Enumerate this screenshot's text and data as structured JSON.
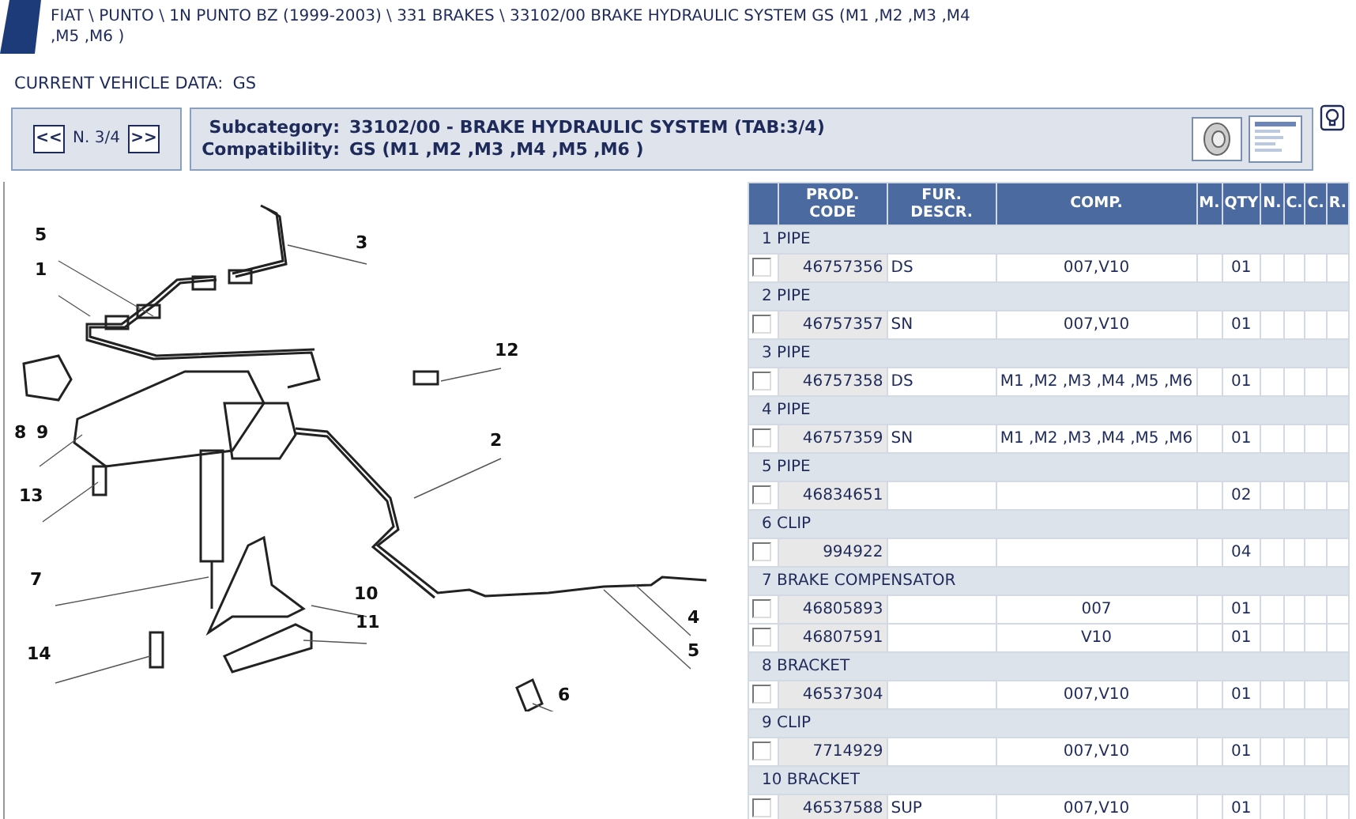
{
  "breadcrumb": "FIAT \\ PUNTO \\ 1N PUNTO BZ (1999-2003) \\ 331 BRAKES \\ 33102/00 BRAKE HYDRAULIC SYSTEM GS (M1 ,M2 ,M3 ,M4 ,M5 ,M6 )",
  "vehicle": {
    "label": "CURRENT VEHICLE DATA:",
    "value": "GS"
  },
  "nav": {
    "prev": "<<",
    "page": "N. 3/4",
    "next": ">>"
  },
  "info": {
    "subcategory_label": "Subcategory:",
    "subcategory": "33102/00 - BRAKE HYDRAULIC SYSTEM (TAB:3/4)",
    "compatibility_label": "Compatibility:",
    "compatibility": "GS (M1 ,M2 ,M3 ,M4 ,M5 ,M6 )"
  },
  "diagram": {
    "callouts": [
      "5",
      "1",
      "3",
      "12",
      "8",
      "9",
      "2",
      "13",
      "7",
      "10",
      "11",
      "14",
      "4",
      "5",
      "6"
    ]
  },
  "table": {
    "columns": [
      "PROD. CODE",
      "FUR. DESCR.",
      "COMP.",
      "M.",
      "QTY",
      "N.",
      "C.",
      "C.",
      "R."
    ],
    "rows": [
      {
        "kind": "group",
        "label": "1 PIPE"
      },
      {
        "kind": "part",
        "checked": false,
        "code": "46757356",
        "fur": "DS",
        "comp": "007,V10",
        "qty": "01"
      },
      {
        "kind": "group",
        "label": "2 PIPE"
      },
      {
        "kind": "part",
        "checked": false,
        "code": "46757357",
        "fur": "SN",
        "comp": "007,V10",
        "qty": "01"
      },
      {
        "kind": "group",
        "label": "3 PIPE"
      },
      {
        "kind": "part",
        "checked": false,
        "code": "46757358",
        "fur": "DS",
        "comp": "M1 ,M2 ,M3 ,M4 ,M5 ,M6",
        "qty": "01"
      },
      {
        "kind": "group",
        "label": "4 PIPE"
      },
      {
        "kind": "part",
        "checked": false,
        "code": "46757359",
        "fur": "SN",
        "comp": "M1 ,M2 ,M3 ,M4 ,M5 ,M6",
        "qty": "01"
      },
      {
        "kind": "group",
        "label": "5 PIPE"
      },
      {
        "kind": "part",
        "checked": false,
        "code": "46834651",
        "qty": "02"
      },
      {
        "kind": "group",
        "label": "6 CLIP"
      },
      {
        "kind": "part",
        "checked": false,
        "code": "994922",
        "qty": "04"
      },
      {
        "kind": "group",
        "label": "7 BRAKE COMPENSATOR"
      },
      {
        "kind": "part",
        "checked": false,
        "code": "46805893",
        "comp": "007",
        "qty": "01"
      },
      {
        "kind": "part",
        "checked": false,
        "code": "46807591",
        "comp": "V10",
        "qty": "01"
      },
      {
        "kind": "group",
        "label": "8 BRACKET"
      },
      {
        "kind": "part",
        "checked": false,
        "code": "46537304",
        "comp": "007,V10",
        "qty": "01"
      },
      {
        "kind": "group",
        "label": "9 CLIP"
      },
      {
        "kind": "part",
        "checked": false,
        "code": "7714929",
        "comp": "007,V10",
        "qty": "01"
      },
      {
        "kind": "group",
        "label": "10 BRACKET"
      },
      {
        "kind": "part",
        "checked": false,
        "code": "46537588",
        "fur": "SUP",
        "comp": "007,V10",
        "qty": "01"
      }
    ]
  }
}
